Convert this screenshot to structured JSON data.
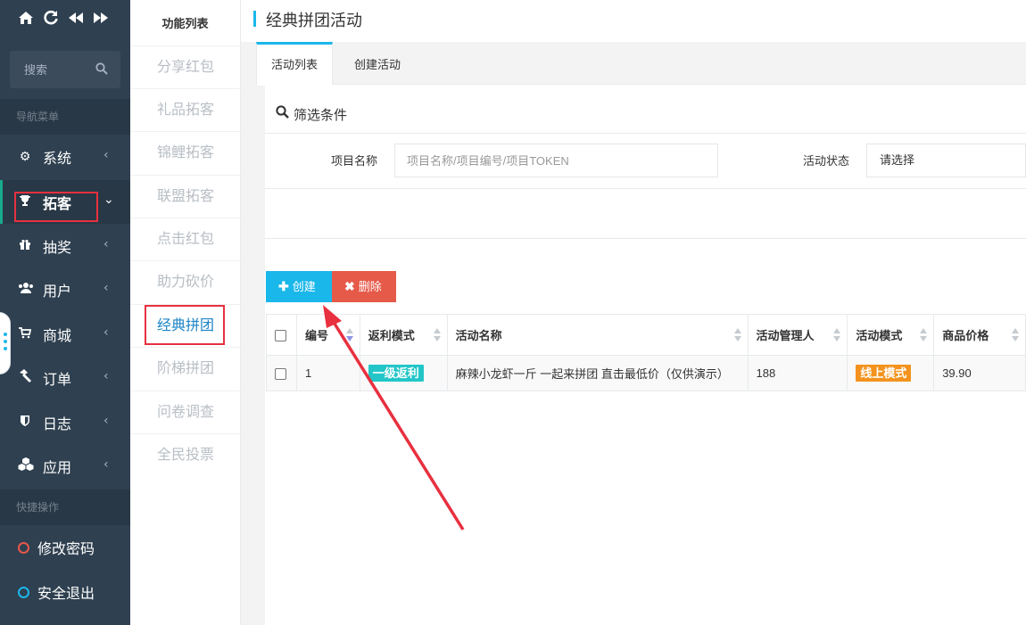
{
  "sidebar": {
    "top_icons": [
      "home-icon",
      "refresh-icon",
      "rewind-icon",
      "fast-forward-icon"
    ],
    "search_placeholder": "搜索",
    "nav_header": "导航菜单",
    "items": [
      {
        "label": "系统",
        "icon": "gear-icon"
      },
      {
        "label": "拓客",
        "icon": "trophy-icon"
      },
      {
        "label": "抽奖",
        "icon": "gift-icon"
      },
      {
        "label": "用户",
        "icon": "users-icon"
      },
      {
        "label": "商城",
        "icon": "cart-icon"
      },
      {
        "label": "订单",
        "icon": "hammer-icon"
      },
      {
        "label": "日志",
        "icon": "shield-icon"
      },
      {
        "label": "应用",
        "icon": "cubes-icon"
      }
    ],
    "quick_header": "快捷操作",
    "quick": [
      {
        "label": "修改密码",
        "color": "#e8574a"
      },
      {
        "label": "安全退出",
        "color": "#1ab7ea"
      }
    ]
  },
  "func_panel": {
    "title": "功能列表",
    "items": [
      "分享红包",
      "礼品拓客",
      "锦鲤拓客",
      "联盟拓客",
      "点击红包",
      "助力砍价",
      "经典拼团",
      "阶梯拼团",
      "问卷调查",
      "全民投票"
    ]
  },
  "page": {
    "title": "经典拼团活动",
    "tabs": [
      "活动列表",
      "创建活动"
    ]
  },
  "filter": {
    "title": "筛选条件",
    "project_label": "项目名称",
    "project_placeholder": "项目名称/项目编号/项目TOKEN",
    "status_label": "活动状态",
    "status_value": "请选择"
  },
  "toolbar": {
    "create_label": "创建",
    "delete_label": "删除"
  },
  "table": {
    "headers": [
      "编号",
      "返利模式",
      "活动名称",
      "活动管理人",
      "活动模式",
      "商品价格"
    ],
    "rows": [
      {
        "id": "1",
        "rebate": "一级返利",
        "name": "麻辣小龙虾一斤 一起来拼团 直击最低价（仅供演示）",
        "manager": "188",
        "mode": "线上模式",
        "price": "39.90"
      }
    ]
  },
  "colors": {
    "sidebar_bg": "#2f4050",
    "accent": "#1ab7ea",
    "danger": "#e65a4a",
    "highlight_box": "#e8303f",
    "badge_teal": "#23c6c8",
    "badge_orange": "#f3931e"
  }
}
